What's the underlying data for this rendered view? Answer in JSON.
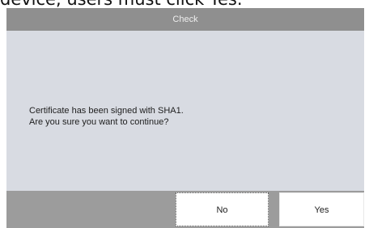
{
  "background_caption": "device, users must click Yes.",
  "dialog": {
    "title": "Check",
    "message_lines": [
      "Certificate has been signed with SHA1.",
      "Are you sure you want to continue?"
    ],
    "buttons": {
      "no": "No",
      "yes": "Yes"
    }
  },
  "colors": {
    "title_bar": "#8f8f8f",
    "content_background": "#d8dbe2",
    "button_bar": "#9c9c9c",
    "button_background": "#ffffff"
  }
}
